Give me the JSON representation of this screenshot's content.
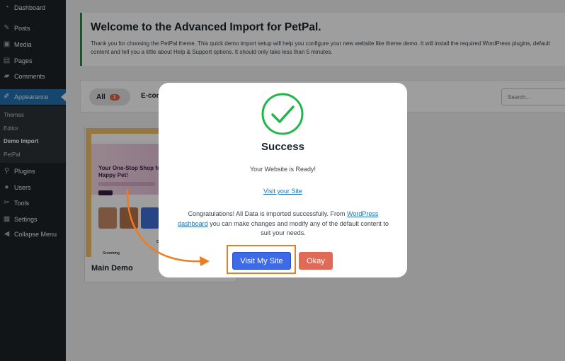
{
  "sidebar": {
    "items": [
      {
        "label": "Dashboard",
        "icon": "dashboard-icon"
      },
      {
        "label": "Posts",
        "icon": "pin-icon"
      },
      {
        "label": "Media",
        "icon": "media-icon"
      },
      {
        "label": "Pages",
        "icon": "pages-icon"
      },
      {
        "label": "Comments",
        "icon": "comments-icon"
      },
      {
        "label": "Appearance",
        "icon": "brush-icon"
      },
      {
        "label": "Plugins",
        "icon": "plugin-icon"
      },
      {
        "label": "Users",
        "icon": "users-icon"
      },
      {
        "label": "Tools",
        "icon": "wrench-icon"
      },
      {
        "label": "Settings",
        "icon": "settings-icon"
      },
      {
        "label": "Collapse Menu",
        "icon": "collapse-icon"
      }
    ],
    "submenu": [
      "Themes",
      "Editor",
      "Demo Import",
      "PetPal"
    ]
  },
  "welcome": {
    "title": "Welcome to the Advanced Import for PetPal.",
    "description": "Thank you for choosing the PetPal theme. This quick demo import setup will help you configure your new website like theme demo. It will install the required WordPress plugins, default content and tell you a little about Help & Support options. It should only take less than 5 minutes."
  },
  "filters": {
    "all_label": "All",
    "all_count": "1",
    "ecommerce_label": "E-com",
    "search_placeholder": "Search..."
  },
  "demo_card": {
    "title": "Main Demo",
    "preview": {
      "hero_title": "Your One-Stop Shop for a Happy Pet!",
      "our_text": "Our",
      "grooming_text": "Grooming"
    }
  },
  "modal": {
    "title": "Success",
    "ready_text": "Your Website is Ready!",
    "visit_link": "Visit your Site",
    "congrats_before": "Congratulations! All Data is imported successfully. From ",
    "congrats_link": "WordPress dashboard",
    "congrats_after": " you can make changes and modify any of the default content to suit your needs.",
    "visit_button": "Visit My Site",
    "okay_button": "Okay"
  },
  "colors": {
    "success_green": "#1fb84a",
    "visit_button_blue": "#3d6ae6",
    "okay_button_red": "#e16a57",
    "annotation_orange": "#f07a1d",
    "active_menu_blue": "#2271b1"
  }
}
